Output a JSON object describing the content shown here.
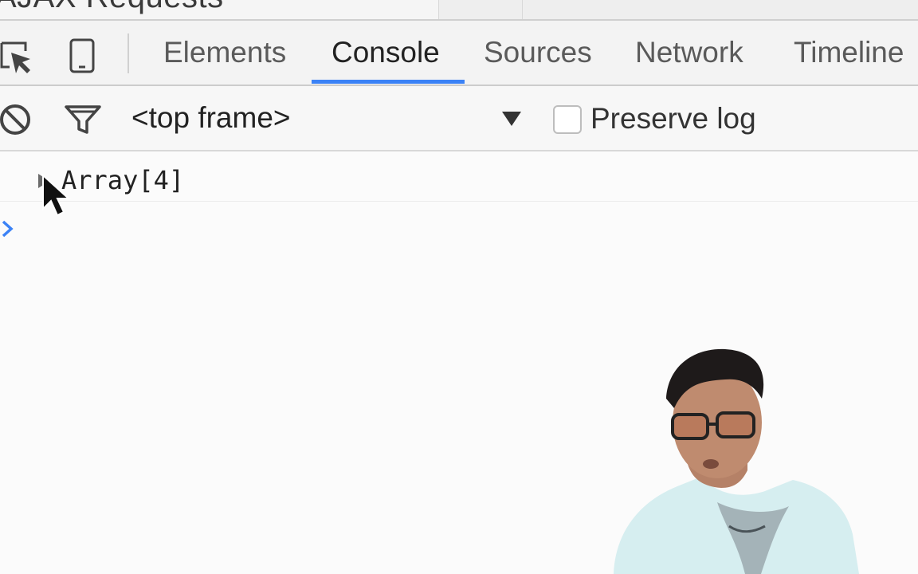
{
  "browser_tab": {
    "title": "AJAX Requests"
  },
  "toolbar": {
    "icons": [
      "inspect-element-icon",
      "device-mode-icon"
    ],
    "tabs": [
      "Elements",
      "Console",
      "Sources",
      "Network",
      "Timeline"
    ],
    "active_tab": "Console"
  },
  "filter_bar": {
    "context": "<top frame>",
    "preserve_log": {
      "label": "Preserve log",
      "checked": false
    }
  },
  "console": {
    "entries": [
      {
        "text": "Array[4]",
        "expandable": true
      }
    ]
  },
  "colors": {
    "accent": "#3b82f6",
    "prompt": "#3b82f6"
  }
}
